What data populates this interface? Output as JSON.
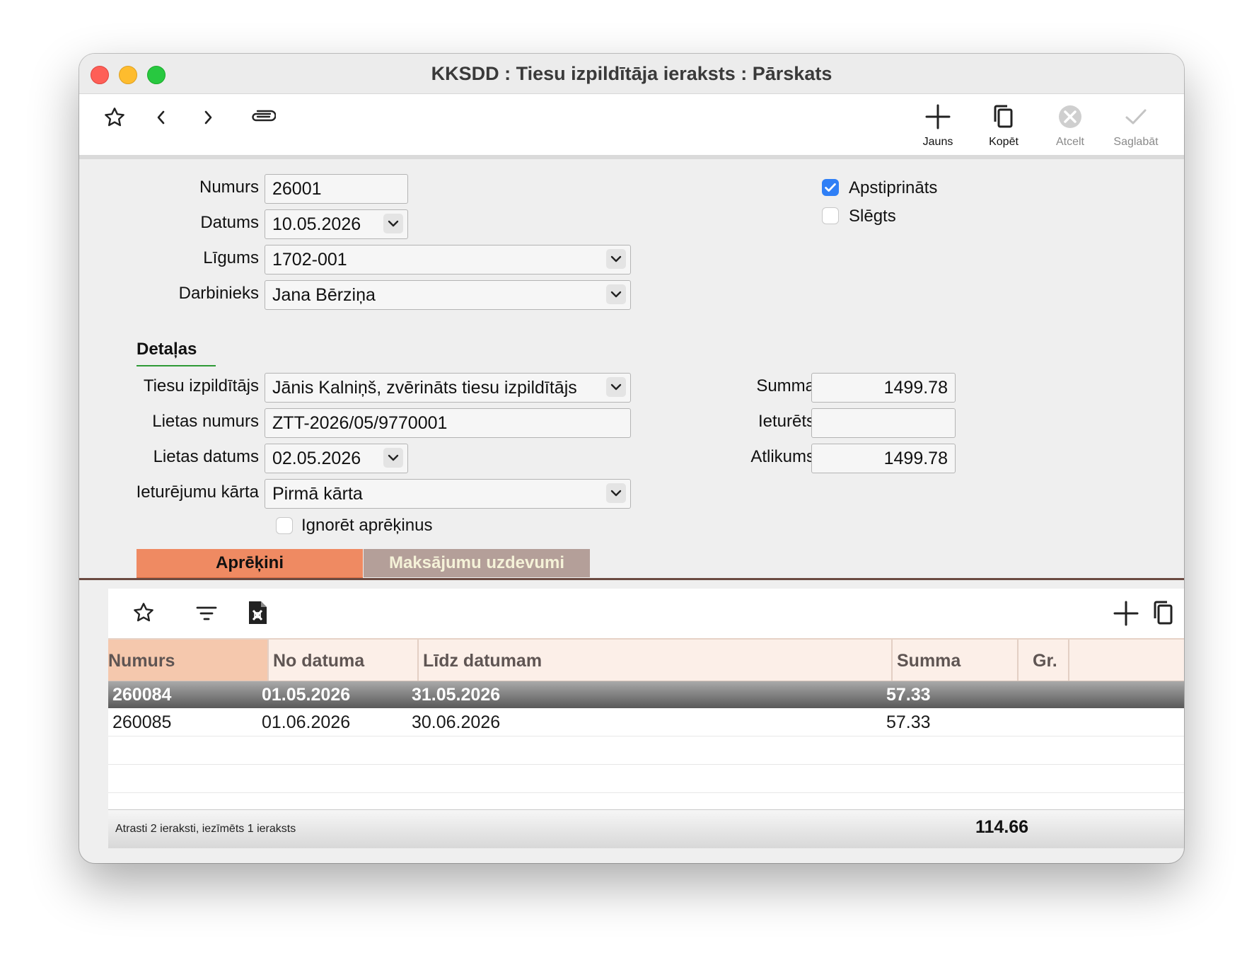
{
  "window": {
    "title": "KKSDD : Tiesu izpildītāja ieraksts : Pārskats"
  },
  "toolbar": {
    "left_icons": [
      "star-icon",
      "chevron-left-icon",
      "chevron-right-icon",
      "paperclip-icon"
    ],
    "new_label": "Jauns",
    "copy_label": "Kopēt",
    "cancel_label": "Atcelt",
    "save_label": "Saglabāt"
  },
  "form": {
    "number_label": "Numurs",
    "number_value": "26001",
    "date_label": "Datums",
    "date_value": "10.05.2026",
    "contract_label": "Līgums",
    "contract_value": "1702-001",
    "employee_label": "Darbinieks",
    "employee_value": "Jana Bērziņa",
    "approved_label": "Apstiprināts",
    "approved_checked": true,
    "closed_label": "Slēgts",
    "closed_checked": false
  },
  "details": {
    "section_title": "Detaļas",
    "bailiff_label": "Tiesu izpildītājs",
    "bailiff_value": "Jānis Kalniņš, zvērināts tiesu izpildītājs",
    "case_number_label": "Lietas numurs",
    "case_number_value": "ZTT-2026/05/9770001",
    "case_date_label": "Lietas datums",
    "case_date_value": "02.05.2026",
    "order_label": "Ieturējumu kārta",
    "order_value": "Pirmā kārta",
    "ignore_label": "Ignorēt aprēķinus",
    "ignore_checked": false,
    "sum_label": "Summa",
    "sum_value": "1499.78",
    "withheld_label": "Ieturēts",
    "withheld_value": "",
    "balance_label": "Atlikums",
    "balance_value": "1499.78"
  },
  "tabs": [
    {
      "label": "Aprēķini",
      "active": true
    },
    {
      "label": "Maksājumu uzdevumi",
      "active": false
    }
  ],
  "subtoolbar": {
    "left_icons": [
      "star-icon",
      "filter-icon",
      "export-file-icon"
    ],
    "right_icons": [
      "add-icon",
      "copy-icon"
    ]
  },
  "table": {
    "columns": [
      "Numurs",
      "No datuma",
      "Līdz datumam",
      "Summa",
      "Gr."
    ],
    "rows": [
      {
        "numurs": "260084",
        "no": "01.05.2026",
        "lidz": "31.05.2026",
        "summa": "57.33",
        "gr": "",
        "selected": true
      },
      {
        "numurs": "260085",
        "no": "01.06.2026",
        "lidz": "30.06.2026",
        "summa": "57.33",
        "gr": "",
        "selected": false
      }
    ]
  },
  "footer": {
    "status": "Atrasti 2 ieraksti, iezīmēts 1 ieraksts",
    "total": "114.66"
  },
  "colors": {
    "accent_active_tab": "#ef8a62",
    "inactive_tab": "#b49f99",
    "checkbox_blue": "#2f7ff6",
    "section_underline": "#2e9a36"
  }
}
